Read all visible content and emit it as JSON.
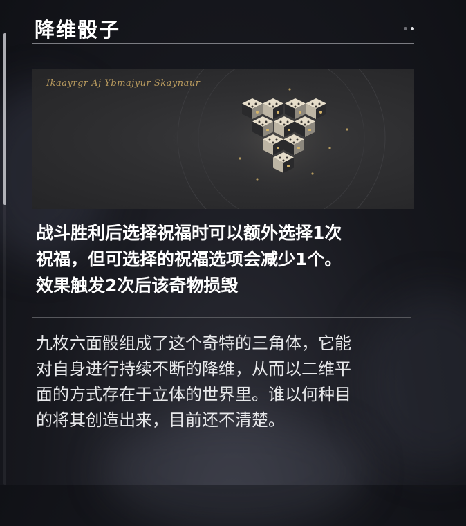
{
  "panel": {
    "title": "降维骰子",
    "art": {
      "script_text": "Ikaayrgr Aj Ybmajyur Skaynaur"
    },
    "effect_text": "战斗胜利后选择祝福时可以额外选择1次\n祝福，但可选择的祝福选项会减少1个。\n效果触发2次后该奇物损毁",
    "lore_text": "九枚六面骰组成了这个奇特的三角体，它能\n对自身进行持续不断的降维，从而以二维平\n面的方式存在于立体的世界里。谁以何种目\n的将其创造出来，目前还不清楚。"
  },
  "colors": {
    "title": "#ffffff",
    "title_rule": "#7b7c82",
    "art_script": "#b89a5e",
    "dice_face": "#e6ddca",
    "dice_dark": "#2a2a2c",
    "pip_gold": "#d4b46a"
  },
  "icons": {
    "title_menu": "dots-icon",
    "artwork": "dice-triangle-icon"
  }
}
